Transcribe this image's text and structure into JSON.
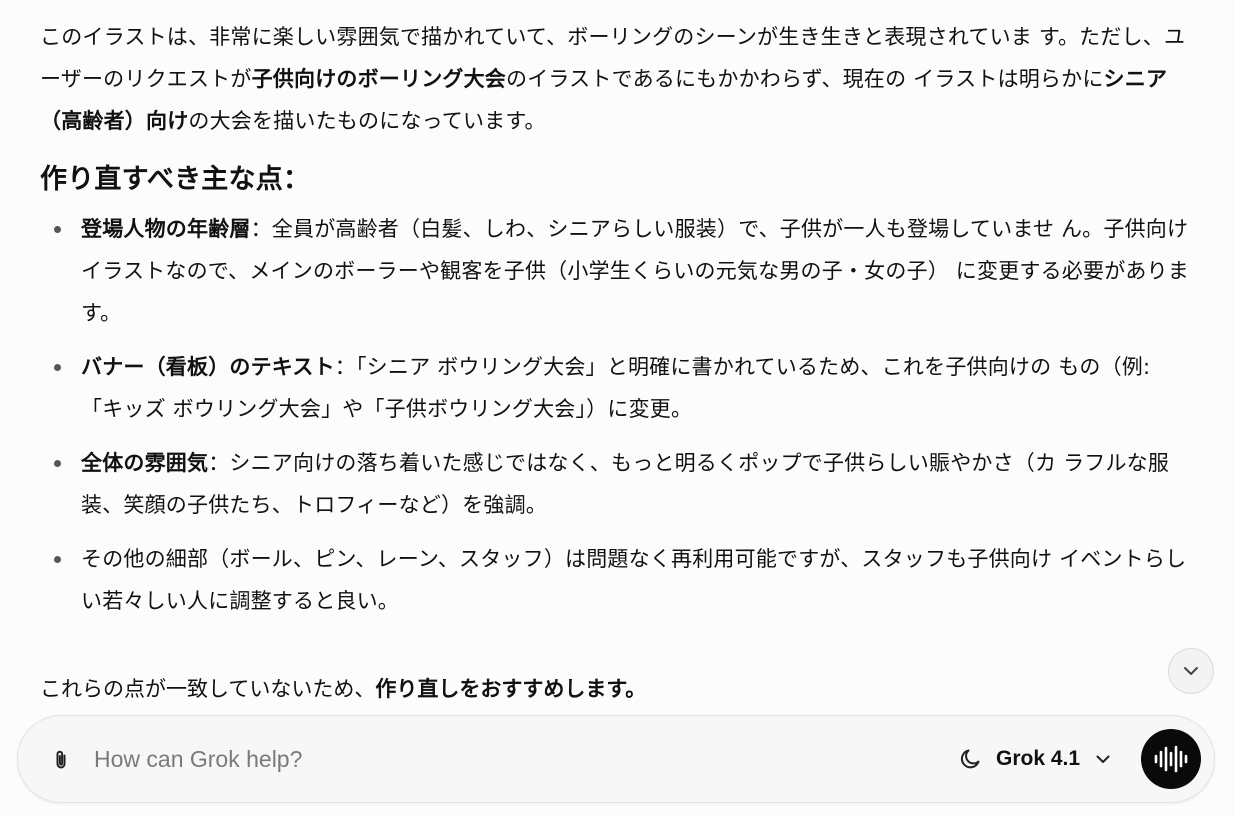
{
  "message": {
    "intro": {
      "t1": "このイラストは、非常に楽しい雰囲気で描かれていて、ボーリングのシーンが生き生きと表現されていま す。ただし、ユーザーのリクエストが",
      "b1": "子供向けのボーリング大会",
      "t2": "のイラストであるにもかかわらず、現在の イラストは明らかに",
      "b2": "シニア（高齢者）向け",
      "t3": "の大会を描いたものになっています。"
    },
    "heading": "作り直すべき主な点：",
    "points": [
      {
        "bold": "登場人物の年齢層",
        "text": "：全員が高齢者（白髪、しわ、シニアらしい服装）で、子供が一人も登場していませ ん。子供向けイラストなので、メインのボーラーや観客を子供（小学生くらいの元気な男の子・女の子） に変更する必要があります。"
      },
      {
        "bold": "バナー（看板）のテキスト",
        "text": "：「シニア ボウリング大会」と明確に書かれているため、これを子供向けの もの（例: 「キッズ ボウリング大会」や「子供ボウリング大会」）に変更。"
      },
      {
        "bold": "全体の雰囲気",
        "text": "：シニア向けの落ち着いた感じではなく、もっと明るくポップで子供らしい賑やかさ（カ ラフルな服装、笑顔の子供たち、トロフィーなど）を強調。"
      },
      {
        "bold": "",
        "text": "その他の細部（ボール、ピン、レーン、スタッフ）は問題なく再利用可能ですが、スタッフも子供向け イベントらしい若々しい人に調整すると良い。"
      }
    ],
    "closing": {
      "text": "これらの点が一致していないため、",
      "bold": "作り直しをおすすめします。"
    }
  },
  "composer": {
    "placeholder": "How can Grok help?",
    "value": "",
    "model": "Grok 4.1",
    "icons": {
      "attach": "paperclip-icon",
      "mode": "moon-icon",
      "model_dropdown": "chevron-down-icon",
      "voice": "voice-waveform-icon",
      "scroll": "chevron-down-icon"
    }
  },
  "colors": {
    "background": "#fcfcfc",
    "text": "#111111",
    "voice_button": "#0a0a0a",
    "placeholder": "#7a7a7a"
  }
}
